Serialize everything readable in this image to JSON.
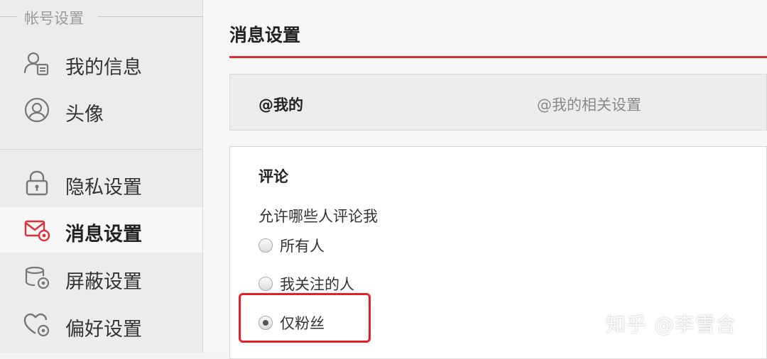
{
  "sidebar": {
    "group_label": "帐号设置",
    "items": [
      {
        "label": "我的信息",
        "icon": "user-card-icon"
      },
      {
        "label": "头像",
        "icon": "avatar-icon"
      },
      {
        "label": "隐私设置",
        "icon": "lock-icon"
      },
      {
        "label": "消息设置",
        "icon": "message-settings-icon",
        "active": true
      },
      {
        "label": "屏蔽设置",
        "icon": "block-settings-icon"
      },
      {
        "label": "偏好设置",
        "icon": "preference-settings-icon"
      }
    ]
  },
  "main": {
    "title": "消息设置",
    "at_section": {
      "name": "@我的",
      "description": "@我的相关设置"
    },
    "comment_section": {
      "title": "评论",
      "question": "允许哪些人评论我",
      "options": [
        {
          "label": "所有人",
          "selected": false
        },
        {
          "label": "我关注的人",
          "selected": false
        },
        {
          "label": "仅粉丝",
          "selected": true
        }
      ]
    }
  },
  "watermark": "知乎 @李雪含",
  "colors": {
    "accent": "#d8303a",
    "highlight": "#e5202b",
    "active_icon": "#e0303a"
  }
}
